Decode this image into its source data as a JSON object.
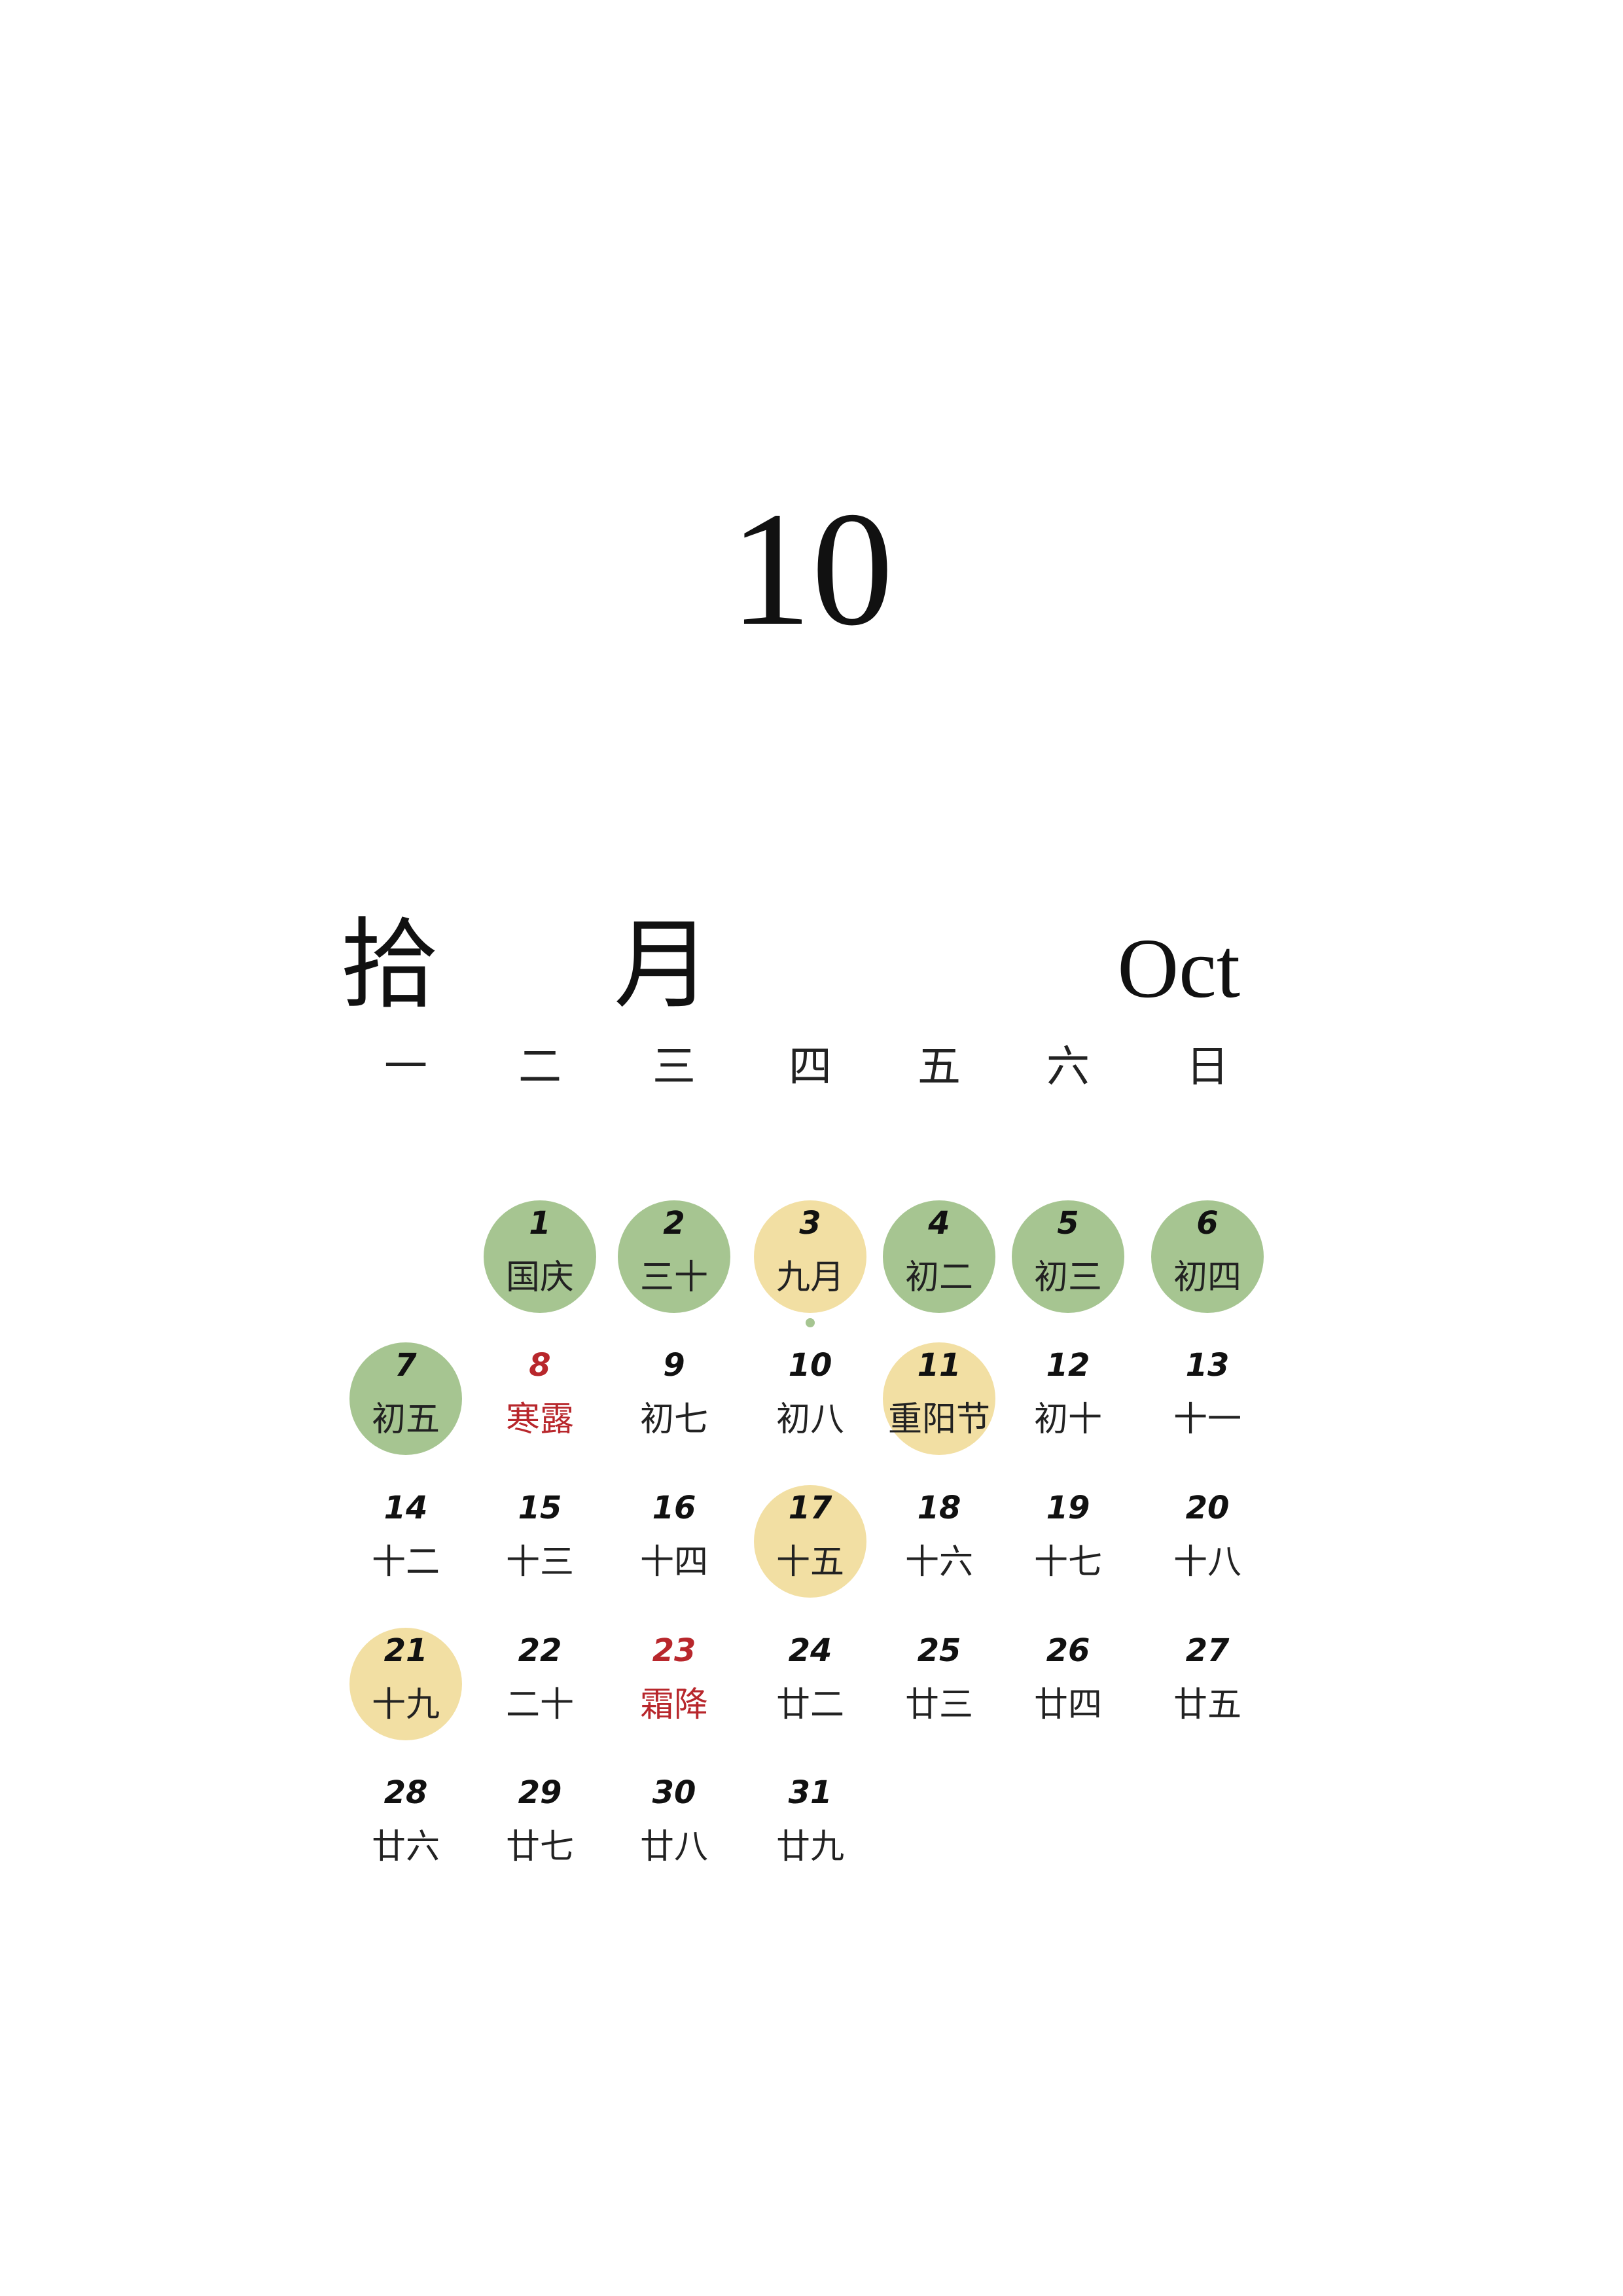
{
  "page_number": "10",
  "month_cn": "拾 月",
  "month_en": "Oct",
  "colors": {
    "green": "#a6c591",
    "yellow": "#f2dfa3",
    "red": "#b8272c",
    "text": "#111111"
  },
  "weekdays": [
    "一",
    "二",
    "三",
    "四",
    "五",
    "六",
    "日"
  ],
  "days": [
    {
      "day": "1",
      "lunar": "国庆",
      "highlight": "green",
      "row": 0,
      "col": 1
    },
    {
      "day": "2",
      "lunar": "三十",
      "highlight": "green",
      "row": 0,
      "col": 2
    },
    {
      "day": "3",
      "lunar": "九月",
      "highlight": "yellow",
      "row": 0,
      "col": 3
    },
    {
      "day": "4",
      "lunar": "初二",
      "highlight": "green",
      "row": 0,
      "col": 4
    },
    {
      "day": "5",
      "lunar": "初三",
      "highlight": "green",
      "row": 0,
      "col": 5
    },
    {
      "day": "6",
      "lunar": "初四",
      "highlight": "green",
      "row": 0,
      "col": 6
    },
    {
      "day": "7",
      "lunar": "初五",
      "highlight": "green",
      "row": 1,
      "col": 0
    },
    {
      "day": "8",
      "lunar": "寒露",
      "highlight": "none",
      "red": true,
      "row": 1,
      "col": 1
    },
    {
      "day": "9",
      "lunar": "初七",
      "highlight": "none",
      "row": 1,
      "col": 2
    },
    {
      "day": "10",
      "lunar": "初八",
      "highlight": "none",
      "row": 1,
      "col": 3
    },
    {
      "day": "11",
      "lunar": "重阳节",
      "highlight": "yellow",
      "row": 1,
      "col": 4
    },
    {
      "day": "12",
      "lunar": "初十",
      "highlight": "none",
      "row": 1,
      "col": 5
    },
    {
      "day": "13",
      "lunar": "十一",
      "highlight": "none",
      "row": 1,
      "col": 6
    },
    {
      "day": "14",
      "lunar": "十二",
      "highlight": "none",
      "row": 2,
      "col": 0
    },
    {
      "day": "15",
      "lunar": "十三",
      "highlight": "none",
      "row": 2,
      "col": 1
    },
    {
      "day": "16",
      "lunar": "十四",
      "highlight": "none",
      "row": 2,
      "col": 2
    },
    {
      "day": "17",
      "lunar": "十五",
      "highlight": "yellow",
      "row": 2,
      "col": 3
    },
    {
      "day": "18",
      "lunar": "十六",
      "highlight": "none",
      "row": 2,
      "col": 4
    },
    {
      "day": "19",
      "lunar": "十七",
      "highlight": "none",
      "row": 2,
      "col": 5
    },
    {
      "day": "20",
      "lunar": "十八",
      "highlight": "none",
      "row": 2,
      "col": 6
    },
    {
      "day": "21",
      "lunar": "十九",
      "highlight": "yellow",
      "row": 3,
      "col": 0
    },
    {
      "day": "22",
      "lunar": "二十",
      "highlight": "none",
      "row": 3,
      "col": 1
    },
    {
      "day": "23",
      "lunar": "霜降",
      "highlight": "none",
      "red": true,
      "row": 3,
      "col": 2
    },
    {
      "day": "24",
      "lunar": "廿二",
      "highlight": "none",
      "row": 3,
      "col": 3
    },
    {
      "day": "25",
      "lunar": "廿三",
      "highlight": "none",
      "row": 3,
      "col": 4
    },
    {
      "day": "26",
      "lunar": "廿四",
      "highlight": "none",
      "row": 3,
      "col": 5
    },
    {
      "day": "27",
      "lunar": "廿五",
      "highlight": "none",
      "row": 3,
      "col": 6
    },
    {
      "day": "28",
      "lunar": "廿六",
      "highlight": "none",
      "row": 4,
      "col": 0
    },
    {
      "day": "29",
      "lunar": "廿七",
      "highlight": "none",
      "row": 4,
      "col": 1
    },
    {
      "day": "30",
      "lunar": "廿八",
      "highlight": "none",
      "row": 4,
      "col": 2
    },
    {
      "day": "31",
      "lunar": "廿九",
      "highlight": "none",
      "row": 4,
      "col": 3
    }
  ]
}
